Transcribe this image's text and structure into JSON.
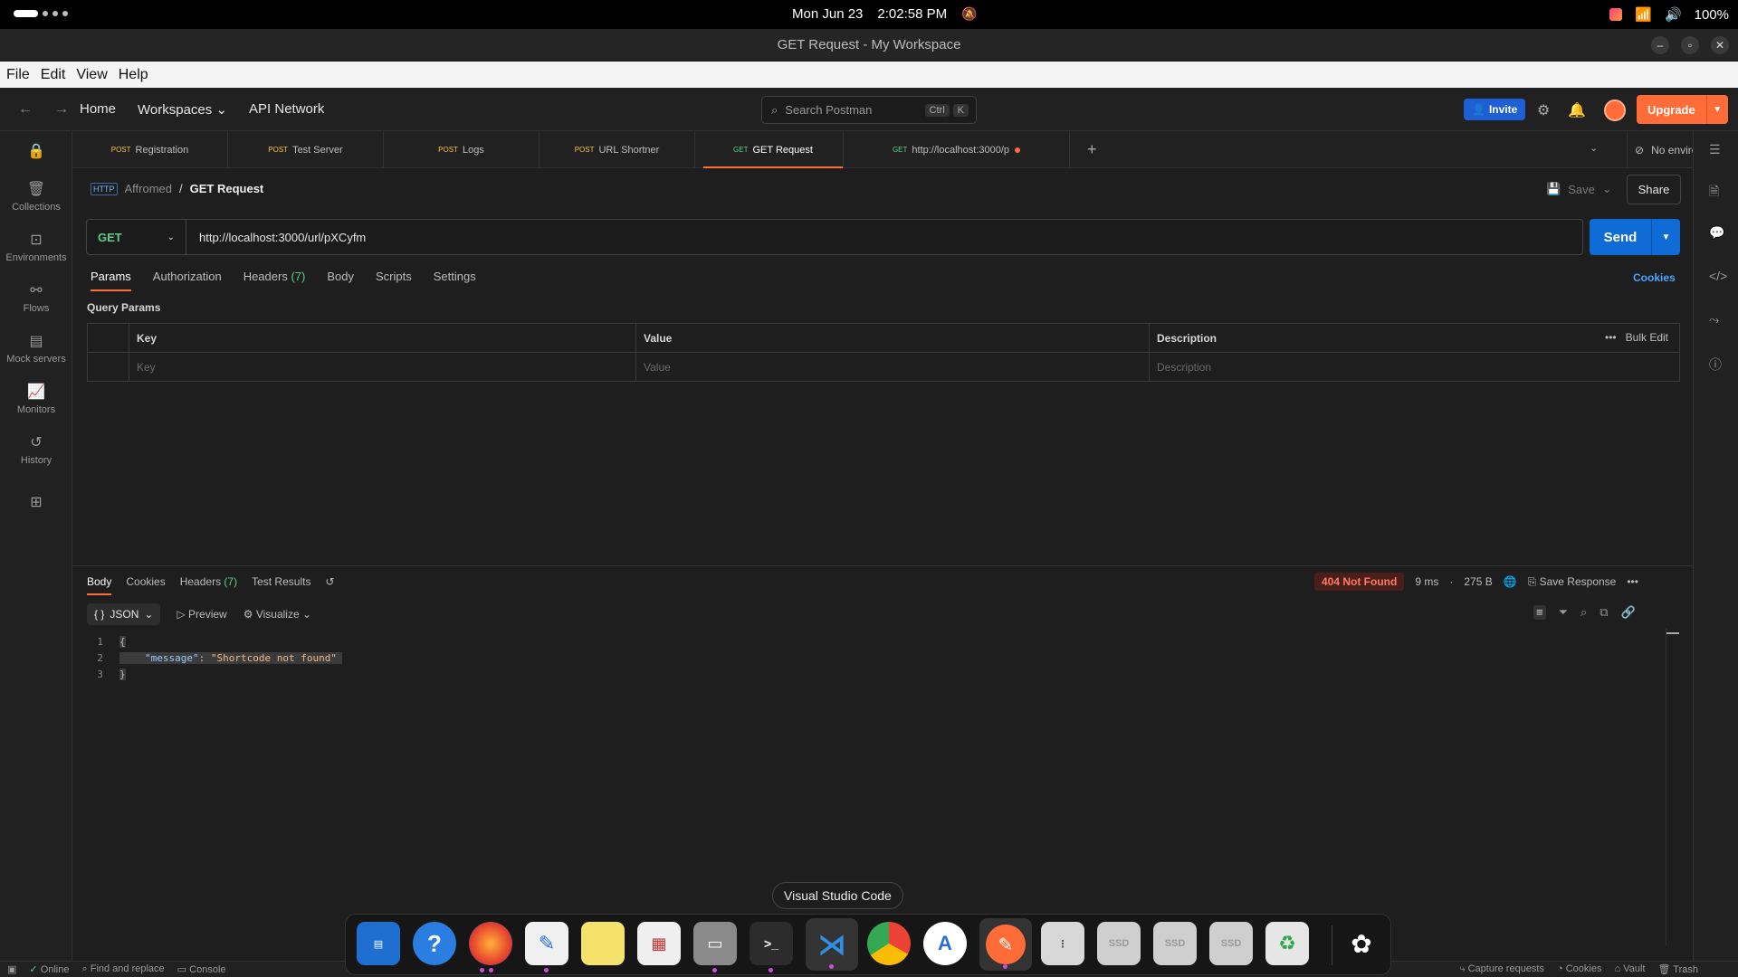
{
  "system": {
    "date": "Mon Jun 23",
    "time": "2:02:58 PM",
    "battery": "100%"
  },
  "window": {
    "title": "GET Request - My Workspace"
  },
  "menu": [
    "File",
    "Edit",
    "View",
    "Help"
  ],
  "header": {
    "nav": [
      "Home",
      "Workspaces",
      "API Network"
    ],
    "workspaces_chevron": "⌄",
    "search_placeholder": "Search Postman",
    "shortcut": [
      "Ctrl",
      "K"
    ],
    "invite": "Invite",
    "upgrade": "Upgrade"
  },
  "sidebar": {
    "items": [
      "Collections",
      "Environments",
      "Flows",
      "Mock servers",
      "Monitors",
      "History"
    ]
  },
  "tabs": [
    {
      "method": "POST",
      "name": "Registration"
    },
    {
      "method": "POST",
      "name": "Test Server"
    },
    {
      "method": "POST",
      "name": "Logs"
    },
    {
      "method": "POST",
      "name": "URL Shortner"
    },
    {
      "method": "GET",
      "name": "GET Request"
    },
    {
      "method": "GET",
      "name": "http://localhost:3000/p"
    }
  ],
  "environment": "No environment",
  "request": {
    "breadcrumb_workspace": "Affromed",
    "breadcrumb_request": "GET Request",
    "http_badge": "HTTP",
    "save": "Save",
    "share": "Share",
    "method": "GET",
    "url": "http://localhost:3000/url/pXCyfm",
    "send": "Send",
    "tabs": [
      "Params",
      "Authorization",
      "Headers",
      "Body",
      "Scripts",
      "Settings"
    ],
    "headers_count": "(7)",
    "cookies": "Cookies",
    "query_params_title": "Query Params",
    "columns": [
      "Key",
      "Value",
      "Description"
    ],
    "placeholders": [
      "Key",
      "Value",
      "Description"
    ],
    "bulk_edit": "Bulk Edit"
  },
  "response": {
    "tabs": [
      "Body",
      "Cookies",
      "Headers",
      "Test Results"
    ],
    "headers_count": "(7)",
    "status": "404 Not Found",
    "time": "9 ms",
    "size": "275 B",
    "save_response": "Save Response",
    "format": "JSON",
    "format_icon": "{ }",
    "preview": "Preview",
    "visualize": "Visualize",
    "lines": [
      {
        "n": "1",
        "brace": "{"
      },
      {
        "n": "2",
        "key": "\"message\"",
        "colon": ": ",
        "value": "\"Shortcode not found\""
      },
      {
        "n": "3",
        "brace": "}"
      }
    ]
  },
  "statusbar": {
    "left": [
      "Online",
      "Find and replace",
      "Console"
    ],
    "right": [
      "Capture requests",
      "Cookies",
      "Vault",
      "Trash"
    ]
  },
  "dock": {
    "tooltip": "Visual Studio Code",
    "drive_label": "SSD"
  },
  "colors": {
    "accent": "#ff6c37",
    "send": "#0f6bd6",
    "get": "#5bcf8a",
    "post": "#f5c542",
    "error": "#ff7a66"
  }
}
